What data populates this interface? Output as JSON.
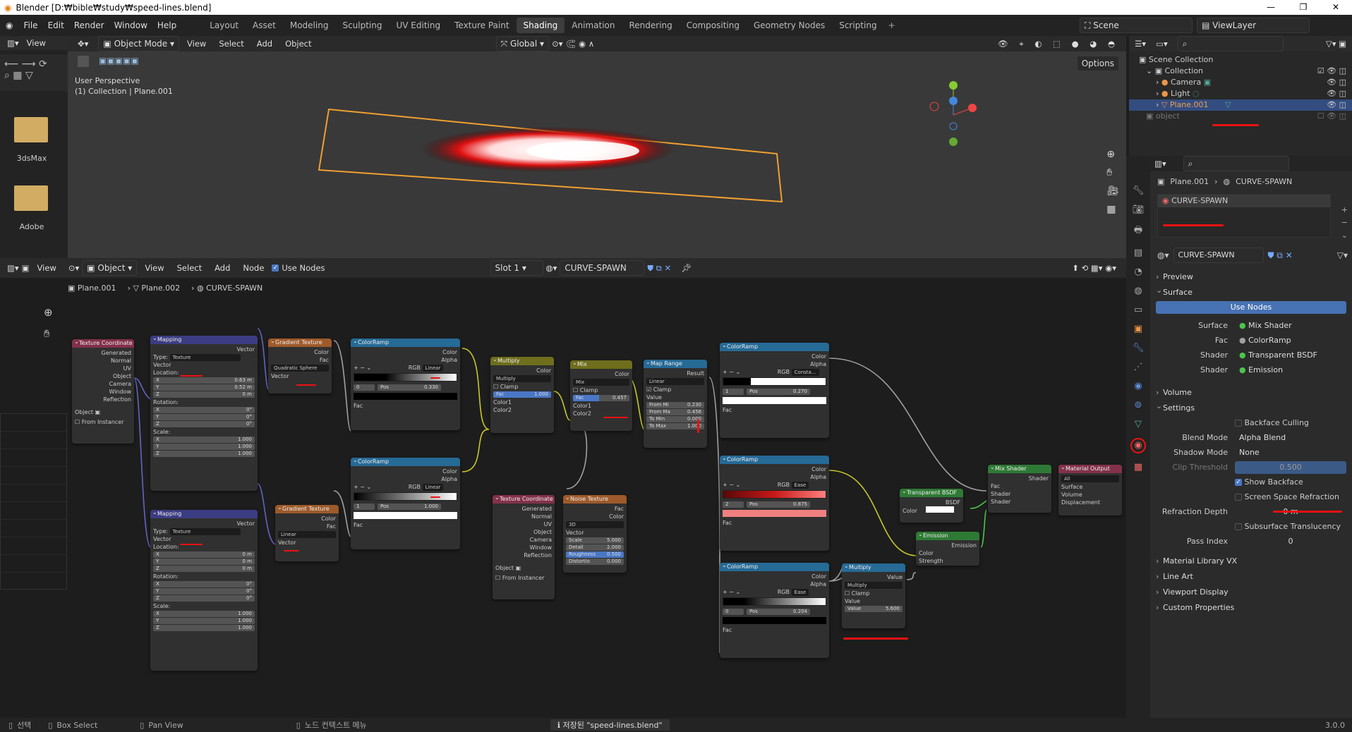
{
  "window": {
    "title": "Blender [D:₩bible₩study₩speed-lines.blend]"
  },
  "menus": [
    "File",
    "Edit",
    "Render",
    "Window",
    "Help"
  ],
  "workspaces": [
    "Layout",
    "Asset",
    "Modeling",
    "Sculpting",
    "UV Editing",
    "Texture Paint",
    "Shading",
    "Animation",
    "Rendering",
    "Compositing",
    "Geometry Nodes",
    "Scripting"
  ],
  "active_workspace": "Shading",
  "scene": "Scene",
  "view_layer": "ViewLayer",
  "file_browser": {
    "view": "View",
    "folders": [
      {
        "label": "3dsMax"
      },
      {
        "label": "Adobe"
      }
    ]
  },
  "viewport": {
    "mode": "Object Mode",
    "menus": [
      "View",
      "Select",
      "Add",
      "Object"
    ],
    "orientation": "Global",
    "options": "Options",
    "info_line1": "User Perspective",
    "info_line2": "(1) Collection | Plane.001"
  },
  "outliner": {
    "title": "Scene Collection",
    "items": [
      {
        "label": "Collection"
      },
      {
        "label": "Camera"
      },
      {
        "label": "Light"
      },
      {
        "label": "Plane.001"
      },
      {
        "label": "object"
      }
    ]
  },
  "node_editor": {
    "view": "View",
    "editor": "Object",
    "menus": [
      "View",
      "Select",
      "Add",
      "Node"
    ],
    "use_nodes": "Use Nodes",
    "slot": "Slot 1",
    "material": "CURVE-SPAWN",
    "breadcrumb": [
      "Plane.001",
      "Plane.002",
      "CURVE-SPAWN"
    ]
  },
  "nodes": {
    "texcoord": "Texture Coordinate",
    "tc_out": [
      "Generated",
      "Normal",
      "UV",
      "Object",
      "Camera",
      "Window",
      "Reflection"
    ],
    "tc_object": "Object",
    "tc_instancer": "From Instancer",
    "mapping1": "Mapping",
    "m_vector": "Vector",
    "m_type_lbl": "Type:",
    "m_type": "Texture",
    "m_vec_in": "Vector",
    "m_loc": "Location:",
    "m_rot": "Rotation:",
    "m_scale": "Scale:",
    "m1_loc": [
      "0.63 m",
      "0.52 m",
      "0 m"
    ],
    "m_rotv": [
      "0°",
      "0°",
      "0°"
    ],
    "m_scalev": [
      "1.000",
      "1.000",
      "1.000"
    ],
    "axes": [
      "X",
      "Y",
      "Z"
    ],
    "mapping2": "Mapping",
    "m2_loc": [
      "0 m",
      "0 m",
      "0 m"
    ],
    "grad1": "Gradient Texture",
    "g_color": "Color",
    "g_fac": "Fac",
    "g1_type": "Quadratic Sphere",
    "g_vector": "Vector",
    "grad2": "Gradient Texture",
    "g2_type": "Linear",
    "cr1": "ColorRamp",
    "cr_color": "Color",
    "cr_alpha": "Alpha",
    "cr_rgb": "RGB",
    "cr1_interp": "Linear",
    "cr1_idx": "0",
    "cr_pos": "Pos",
    "cr1_pos": "0.330",
    "cr_fac": "Fac",
    "cr2": "ColorRamp",
    "cr2_interp": "Linear",
    "cr2_idx": "1",
    "cr2_pos": "1.000",
    "mult1": "Multiply",
    "mult1_color": "Color",
    "mult1_op": "Multiply",
    "clamp": "Clamp",
    "fac_lbl": "Fac",
    "mult1_fac": "1.000",
    "color1": "Color1",
    "color2": "Color2",
    "mix": "Mix",
    "mix_color": "Color",
    "mix_op": "Mix",
    "mix_fac": "0.457",
    "maprange": "Map Range",
    "mr_result": "Result",
    "mr_interp": "Linear",
    "mr_value": "Value",
    "mr_fields": [
      [
        "From Mi",
        "0.230"
      ],
      [
        "From Ma",
        "0.456"
      ],
      [
        "To Min",
        "0.000"
      ],
      [
        "To Max",
        "1.000"
      ]
    ],
    "texcoord2": "Texture Coordinate",
    "noise": "Noise Texture",
    "nz_fac": "Fac",
    "nz_color": "Color",
    "nz_dim": "3D",
    "nz_vector": "Vector",
    "nz_fields": [
      [
        "Scale",
        "5.000"
      ],
      [
        "Detail",
        "2.000"
      ],
      [
        "Roughness",
        "0.500"
      ],
      [
        "Distortio",
        "0.000"
      ]
    ],
    "cr3": "ColorRamp",
    "cr3_interp": "Consta...",
    "cr3_idx": "1",
    "cr3_pos": "0.270",
    "cr4": "ColorRamp",
    "cr4_interp": "Ease",
    "cr4_idx": "2",
    "cr4_pos": "0.875",
    "cr5": "ColorRamp",
    "cr5_interp": "Ease",
    "cr5_idx": "0",
    "cr5_pos": "0.204",
    "mult2": "Multiply",
    "mult2_value": "Value",
    "mult2_op": "Multiply",
    "mult2_val": "5.600",
    "tbsdf": "Transparent BSDF",
    "bsdf": "BSDF",
    "emission": "Emission",
    "em_strength": "Strength",
    "mixsh": "Mix Shader",
    "shader": "Shader",
    "matout": "Material Output",
    "mo_target": "All",
    "mo_in": [
      "Surface",
      "Volume",
      "Displacement"
    ]
  },
  "props": {
    "breadcrumb": [
      "Plane.001",
      "CURVE-SPAWN"
    ],
    "slot_name": "CURVE-SPAWN",
    "material": "CURVE-SPAWN",
    "preview": "Preview",
    "surface": "Surface",
    "use_nodes": "Use Nodes",
    "surface_rows": [
      {
        "label": "Surface",
        "value": "Mix Shader"
      },
      {
        "label": "Fac",
        "value": "ColorRamp"
      },
      {
        "label": "Shader",
        "value": "Transparent BSDF"
      },
      {
        "label": "Shader",
        "value": "Emission"
      }
    ],
    "volume": "Volume",
    "settings": "Settings",
    "backface_culling": "Backface Culling",
    "blend_mode_lbl": "Blend Mode",
    "blend_mode": "Alpha Blend",
    "shadow_mode_lbl": "Shadow Mode",
    "shadow_mode": "None",
    "clip_lbl": "Clip Threshold",
    "clip": "0.500",
    "show_backface": "Show Backface",
    "ssr": "Screen Space Refraction",
    "refr_depth_lbl": "Refraction Depth",
    "refr_depth": "0 m",
    "subsurf": "Subsurface Translucency",
    "pass_lbl": "Pass Index",
    "pass": "0",
    "more_panels": [
      "Material Library VX",
      "Line Art",
      "Viewport Display",
      "Custom Properties"
    ]
  },
  "status": {
    "select": "선택",
    "box": "Box Select",
    "pan": "Pan View",
    "ctx": "노드 컨텍스트 메뉴",
    "saved": "저장된 \"speed-lines.blend\"",
    "version": "3.0.0"
  }
}
